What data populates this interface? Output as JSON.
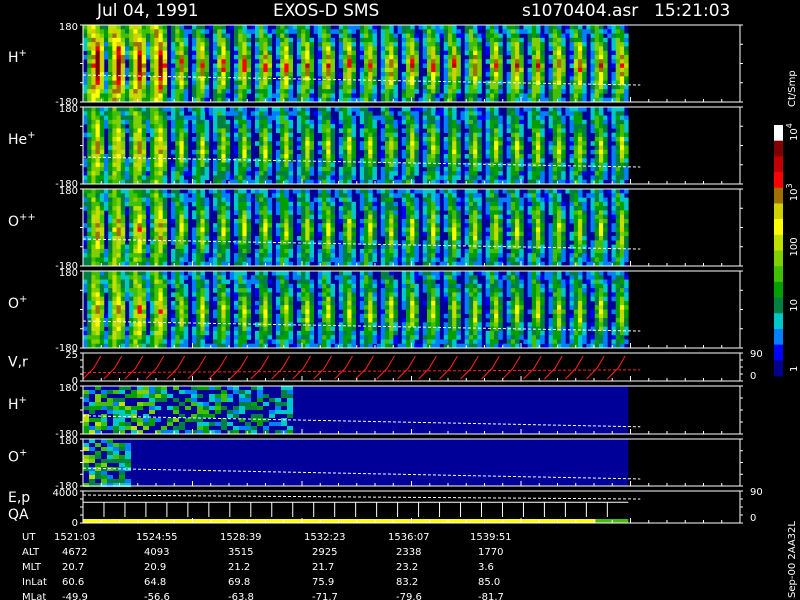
{
  "header": {
    "date": "Jul 04, 1991",
    "title": "EXOS-D SMS",
    "file": "s1070404.asr",
    "time": "15:21:03"
  },
  "colorbar": {
    "unit": "Ct/Smp",
    "tick_labels": [
      "10",
      "10",
      "100",
      "10",
      "1"
    ],
    "exponents": [
      "4",
      "3"
    ],
    "scale": "log",
    "range": [
      1,
      10000
    ],
    "colors": [
      "#00008b",
      "#0000ff",
      "#0080ff",
      "#00c8c8",
      "#008040",
      "#00a000",
      "#40c000",
      "#80d000",
      "#c0e000",
      "#ffff00",
      "#d0d000",
      "#a07000",
      "#ff0000",
      "#c00000",
      "#800000",
      "#ffffff"
    ]
  },
  "side_text": "Sep-00 2AA32L",
  "footer": {
    "rows": [
      {
        "label": "UT",
        "values": [
          "1521:03",
          "1524:55",
          "1528:39",
          "1532:23",
          "1536:07",
          "1539:51"
        ]
      },
      {
        "label": "ALT",
        "values": [
          "4672",
          "4093",
          "3515",
          "2925",
          "2338",
          "1770"
        ]
      },
      {
        "label": "MLT",
        "values": [
          "20.7",
          "20.9",
          "21.2",
          "21.7",
          "23.2",
          "3.6"
        ]
      },
      {
        "label": "InLat",
        "values": [
          "60.6",
          "64.8",
          "69.8",
          "75.9",
          "83.2",
          "85.0"
        ]
      },
      {
        "label": "MLat",
        "values": [
          "-49.9",
          "-56.6",
          "-63.8",
          "-71.7",
          "-79.6",
          "-81.7"
        ]
      }
    ]
  },
  "chart_data": {
    "type": "heatmap",
    "x_ticks": [
      "1521:03",
      "1524:55",
      "1528:39",
      "1532:23",
      "1536:07",
      "1539:51"
    ],
    "data_end_fraction": 0.83,
    "panels": [
      {
        "name": "H+",
        "label": "H",
        "sup": "+",
        "ytop": "180",
        "ybot": "-180",
        "kind": "spin",
        "spins": 26,
        "start": 0,
        "bg": 0,
        "intensity": 0.75,
        "hot": 0.5
      },
      {
        "name": "He+",
        "label": "He",
        "sup": "+",
        "ytop": "180",
        "ybot": "-180",
        "kind": "spin",
        "spins": 26,
        "start": 0,
        "bg": 0,
        "intensity": 0.55,
        "hot": 0.3
      },
      {
        "name": "O++",
        "label": "O",
        "sup": "++",
        "ytop": "180",
        "ybot": "-180",
        "kind": "spin",
        "spins": 26,
        "start": 0,
        "bg": 0,
        "intensity": 0.55,
        "hot": 0.3
      },
      {
        "name": "O+",
        "label": "O",
        "sup": "+",
        "ytop": "180",
        "ybot": "-180",
        "kind": "spin",
        "spins": 26,
        "start": 0,
        "bg": 0,
        "intensity": 0.55,
        "hot": 0.3
      },
      {
        "name": "V,r",
        "label": "V,r",
        "sup": "",
        "ytop": "25",
        "ybot": "0",
        "rtop": "90",
        "rbot": "0",
        "kind": "line"
      },
      {
        "name": "H+ low",
        "label": "H",
        "sup": "+",
        "ytop": "180",
        "ybot": "-180",
        "kind": "patchy",
        "fill_end": 0.38
      },
      {
        "name": "O+ low",
        "label": "O",
        "sup": "+",
        "ytop": "180",
        "ybot": "-180",
        "kind": "patchy",
        "fill_end": 0.08
      },
      {
        "name": "E,p QA",
        "label": "E,p",
        "label2": "QA",
        "ytop": "4000",
        "ybot": "0",
        "rtop": "90",
        "rbot": "0",
        "kind": "steps",
        "qa_colors": [
          "#ffff00",
          "#40c000"
        ]
      }
    ]
  }
}
